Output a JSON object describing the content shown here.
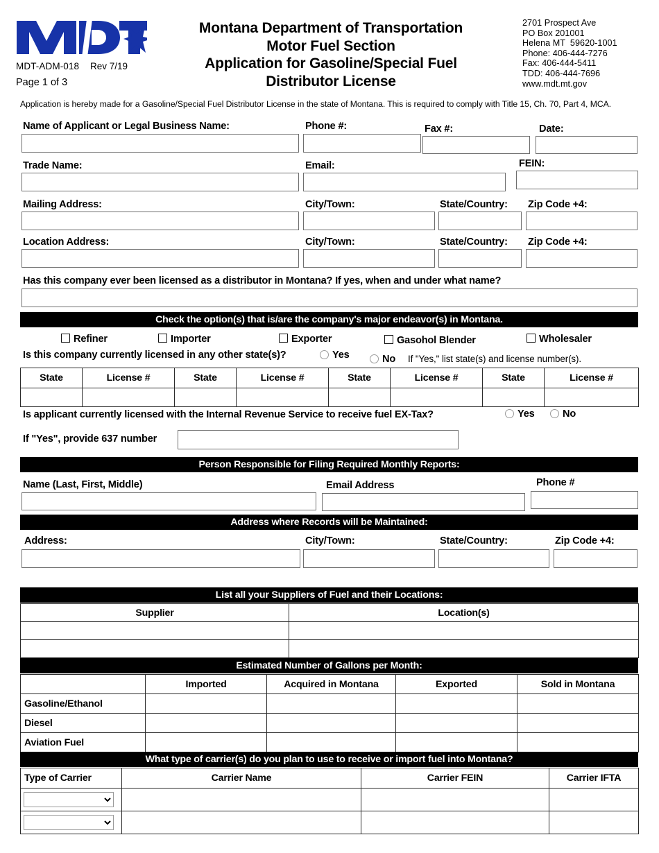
{
  "header": {
    "logo_text": "MDT",
    "doc_id": "MDT-ADM-018",
    "revision": "Rev 7/19",
    "page_label": "Page 1 of 3",
    "title_line1": "Montana Department of Transportation",
    "title_line2": "Motor Fuel Section",
    "title_line3": "Application for Gasoline/Special Fuel",
    "title_line4": "Distributor License",
    "address": "2701 Prospect Ave\nPO Box 201001\nHelena MT  59620-1001\nPhone: 406-444-7276\nFax: 406-444-5411\nTDD: 406-444-7696\nwww.mdt.mt.gov",
    "logo_color": "#1733A8"
  },
  "intro": "Application is hereby made for a Gasoline/Special Fuel Distributor License in the state of Montana. This is required to comply with Title 15, Ch. 70, Part 4, MCA.",
  "applicant": {
    "name_label": "Name of Applicant or Legal Business Name:",
    "phone_label": "Phone #:",
    "fax_label": "Fax #:",
    "date_label": "Date:",
    "trade_name_label": "Trade Name:",
    "email_label": "Email:",
    "fein_label": "FEIN:",
    "mailing_label": "Mailing Address:",
    "mailing_city_label": "City/Town:",
    "mailing_state_label": "State/Country:",
    "mailing_zip_label": "Zip Code +4:",
    "location_label": "Location Address:",
    "location_city_label": "City/Town:",
    "location_state_label": "State/Country:",
    "location_zip_label": "Zip Code +4:",
    "prior_license_question": "Has this company ever been licensed as a distributor in Montana?  If yes, when and under what name?",
    "name_value": "",
    "phone_value": "",
    "fax_value": "",
    "date_value": "",
    "trade_name_value": "",
    "email_value": "",
    "fein_value": "",
    "mailing_value": "",
    "mailing_city_value": "",
    "mailing_state_value": "",
    "mailing_zip_value": "",
    "location_value": "",
    "location_city_value": "",
    "location_state_value": "",
    "location_zip_value": "",
    "prior_license_value": ""
  },
  "endeavors": {
    "bar_title": "Check the option(s) that is/are the company's major endeavor(s) in Montana.",
    "options": [
      {
        "label": "Refiner",
        "checked": false
      },
      {
        "label": "Importer",
        "checked": false
      },
      {
        "label": "Exporter",
        "checked": false
      },
      {
        "label": "Gasohol Blender",
        "checked": false
      },
      {
        "label": "Wholesaler",
        "checked": false
      }
    ]
  },
  "other_states": {
    "question": "Is this company currently licensed in any other state(s)?",
    "yes_label": "Yes",
    "no_label": "No",
    "hint": "If \"Yes,\" list state(s) and license number(s).",
    "selected": "",
    "table": {
      "headers": [
        "State",
        "License #",
        "State",
        "License #",
        "State",
        "License #",
        "State",
        "License #"
      ],
      "rows": [
        [
          "",
          "",
          "",
          "",
          "",
          "",
          "",
          ""
        ]
      ]
    }
  },
  "irs": {
    "question": "Is applicant currently licensed with the Internal Revenue Service to receive fuel EX-Tax?",
    "yes_label": "Yes",
    "no_label": "No",
    "selected": "",
    "number_label": "If \"Yes\", provide 637 number",
    "number_value": ""
  },
  "responsible_person": {
    "bar_title": "Person Responsible for Filing Required Monthly Reports:",
    "name_label": "Name (Last, First, Middle)",
    "email_label": "Email Address",
    "phone_label": "Phone #",
    "name_value": "",
    "email_value": "",
    "phone_value": ""
  },
  "records_address": {
    "bar_title": "Address where Records will be Maintained:",
    "address_label": "Address:",
    "city_label": "City/Town:",
    "state_label": "State/Country:",
    "zip_label": "Zip Code +4:",
    "address_value": "",
    "city_value": "",
    "state_value": "",
    "zip_value": ""
  },
  "suppliers": {
    "bar_title": "List all your Suppliers of Fuel and their Locations:",
    "headers": [
      "Supplier",
      "Location(s)"
    ],
    "rows": [
      [
        "",
        ""
      ],
      [
        "",
        ""
      ]
    ]
  },
  "gallons": {
    "bar_title": "Estimated Number of Gallons per Month:",
    "headers": [
      "",
      "Imported",
      "Acquired in Montana",
      "Exported",
      "Sold in Montana"
    ],
    "rows": [
      {
        "label": "Gasoline/Ethanol",
        "values": [
          "",
          "",
          "",
          ""
        ]
      },
      {
        "label": "Diesel",
        "values": [
          "",
          "",
          "",
          ""
        ]
      },
      {
        "label": "Aviation Fuel",
        "values": [
          "",
          "",
          "",
          ""
        ]
      }
    ]
  },
  "carriers": {
    "bar_title": "What type of carrier(s) do you plan to use to receive or import fuel into Montana?",
    "headers": [
      "Type of Carrier",
      "Carrier Name",
      "Carrier FEIN",
      "Carrier IFTA"
    ],
    "rows": [
      {
        "type": "",
        "name": "",
        "fein": "",
        "ifta": ""
      },
      {
        "type": "",
        "name": "",
        "fein": "",
        "ifta": ""
      }
    ]
  }
}
